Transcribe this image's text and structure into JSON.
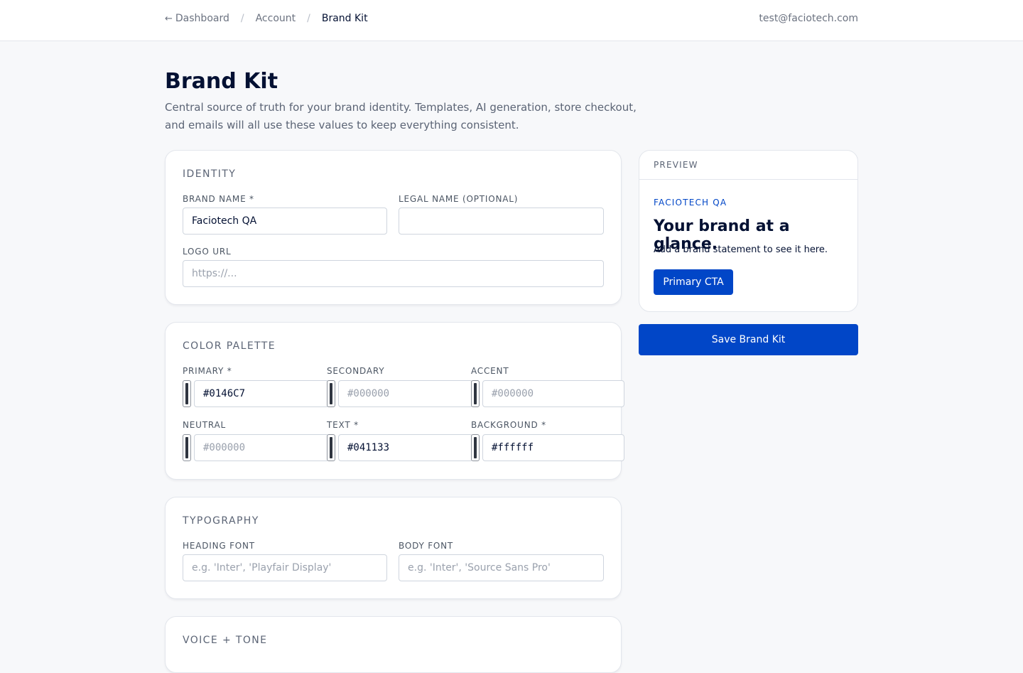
{
  "header": {
    "breadcrumb": {
      "back_icon": "arrow-left-icon",
      "dashboard": "Dashboard",
      "separator": "/",
      "account": "Account",
      "current": "Brand Kit"
    },
    "user_email": "test@faciotech.com"
  },
  "page": {
    "title": "Brand Kit",
    "description": "Central source of truth for your brand identity. Templates, AI generation, store checkout, and emails will all use these values to keep everything consistent."
  },
  "identity": {
    "title": "IDENTITY",
    "brand_name_label": "BRAND NAME *",
    "brand_name_value": "Faciotech QA",
    "legal_name_label": "LEGAL NAME (OPTIONAL)",
    "legal_name_value": "",
    "logo_url_label": "LOGO URL",
    "logo_url_placeholder": "https://..."
  },
  "colors": {
    "title": "COLOR PALETTE",
    "fields": [
      {
        "label": "PRIMARY *",
        "value": "#0146C7",
        "placeholder": ""
      },
      {
        "label": "SECONDARY",
        "value": "",
        "placeholder": "#000000"
      },
      {
        "label": "ACCENT",
        "value": "",
        "placeholder": "#000000"
      },
      {
        "label": "NEUTRAL",
        "value": "",
        "placeholder": "#000000"
      },
      {
        "label": "TEXT *",
        "value": "#041133",
        "placeholder": ""
      },
      {
        "label": "BACKGROUND *",
        "value": "#ffffff",
        "placeholder": ""
      }
    ]
  },
  "typography": {
    "title": "TYPOGRAPHY",
    "heading_font_label": "HEADING FONT",
    "heading_font_placeholder": "e.g. 'Inter', 'Playfair Display'",
    "body_font_label": "BODY FONT",
    "body_font_placeholder": "e.g. 'Inter', 'Source Sans Pro'"
  },
  "voice": {
    "title": "VOICE + TONE"
  },
  "preview": {
    "header": "PREVIEW",
    "brand": "FACIOTECH QA",
    "heading": "Your brand at a glance.",
    "statement": "Add a brand statement to see it here.",
    "cta_label": "Primary CTA"
  },
  "actions": {
    "save_label": "Save Brand Kit"
  },
  "theme": {
    "primary": "#0146C7",
    "text": "#041133",
    "background": "#ffffff",
    "page_background": "#f7f8fa"
  }
}
